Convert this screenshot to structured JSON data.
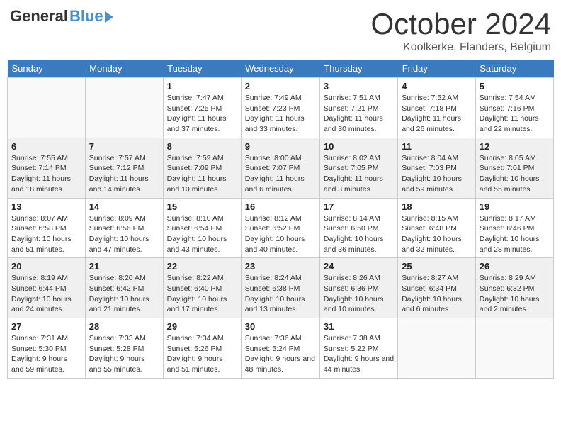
{
  "logo": {
    "general": "General",
    "blue": "Blue"
  },
  "title": "October 2024",
  "location": "Koolkerke, Flanders, Belgium",
  "weekdays": [
    "Sunday",
    "Monday",
    "Tuesday",
    "Wednesday",
    "Thursday",
    "Friday",
    "Saturday"
  ],
  "weeks": [
    [
      {
        "day": "",
        "sunrise": "",
        "sunset": "",
        "daylight": ""
      },
      {
        "day": "",
        "sunrise": "",
        "sunset": "",
        "daylight": ""
      },
      {
        "day": "1",
        "sunrise": "Sunrise: 7:47 AM",
        "sunset": "Sunset: 7:25 PM",
        "daylight": "Daylight: 11 hours and 37 minutes."
      },
      {
        "day": "2",
        "sunrise": "Sunrise: 7:49 AM",
        "sunset": "Sunset: 7:23 PM",
        "daylight": "Daylight: 11 hours and 33 minutes."
      },
      {
        "day": "3",
        "sunrise": "Sunrise: 7:51 AM",
        "sunset": "Sunset: 7:21 PM",
        "daylight": "Daylight: 11 hours and 30 minutes."
      },
      {
        "day": "4",
        "sunrise": "Sunrise: 7:52 AM",
        "sunset": "Sunset: 7:18 PM",
        "daylight": "Daylight: 11 hours and 26 minutes."
      },
      {
        "day": "5",
        "sunrise": "Sunrise: 7:54 AM",
        "sunset": "Sunset: 7:16 PM",
        "daylight": "Daylight: 11 hours and 22 minutes."
      }
    ],
    [
      {
        "day": "6",
        "sunrise": "Sunrise: 7:55 AM",
        "sunset": "Sunset: 7:14 PM",
        "daylight": "Daylight: 11 hours and 18 minutes."
      },
      {
        "day": "7",
        "sunrise": "Sunrise: 7:57 AM",
        "sunset": "Sunset: 7:12 PM",
        "daylight": "Daylight: 11 hours and 14 minutes."
      },
      {
        "day": "8",
        "sunrise": "Sunrise: 7:59 AM",
        "sunset": "Sunset: 7:09 PM",
        "daylight": "Daylight: 11 hours and 10 minutes."
      },
      {
        "day": "9",
        "sunrise": "Sunrise: 8:00 AM",
        "sunset": "Sunset: 7:07 PM",
        "daylight": "Daylight: 11 hours and 6 minutes."
      },
      {
        "day": "10",
        "sunrise": "Sunrise: 8:02 AM",
        "sunset": "Sunset: 7:05 PM",
        "daylight": "Daylight: 11 hours and 3 minutes."
      },
      {
        "day": "11",
        "sunrise": "Sunrise: 8:04 AM",
        "sunset": "Sunset: 7:03 PM",
        "daylight": "Daylight: 10 hours and 59 minutes."
      },
      {
        "day": "12",
        "sunrise": "Sunrise: 8:05 AM",
        "sunset": "Sunset: 7:01 PM",
        "daylight": "Daylight: 10 hours and 55 minutes."
      }
    ],
    [
      {
        "day": "13",
        "sunrise": "Sunrise: 8:07 AM",
        "sunset": "Sunset: 6:58 PM",
        "daylight": "Daylight: 10 hours and 51 minutes."
      },
      {
        "day": "14",
        "sunrise": "Sunrise: 8:09 AM",
        "sunset": "Sunset: 6:56 PM",
        "daylight": "Daylight: 10 hours and 47 minutes."
      },
      {
        "day": "15",
        "sunrise": "Sunrise: 8:10 AM",
        "sunset": "Sunset: 6:54 PM",
        "daylight": "Daylight: 10 hours and 43 minutes."
      },
      {
        "day": "16",
        "sunrise": "Sunrise: 8:12 AM",
        "sunset": "Sunset: 6:52 PM",
        "daylight": "Daylight: 10 hours and 40 minutes."
      },
      {
        "day": "17",
        "sunrise": "Sunrise: 8:14 AM",
        "sunset": "Sunset: 6:50 PM",
        "daylight": "Daylight: 10 hours and 36 minutes."
      },
      {
        "day": "18",
        "sunrise": "Sunrise: 8:15 AM",
        "sunset": "Sunset: 6:48 PM",
        "daylight": "Daylight: 10 hours and 32 minutes."
      },
      {
        "day": "19",
        "sunrise": "Sunrise: 8:17 AM",
        "sunset": "Sunset: 6:46 PM",
        "daylight": "Daylight: 10 hours and 28 minutes."
      }
    ],
    [
      {
        "day": "20",
        "sunrise": "Sunrise: 8:19 AM",
        "sunset": "Sunset: 6:44 PM",
        "daylight": "Daylight: 10 hours and 24 minutes."
      },
      {
        "day": "21",
        "sunrise": "Sunrise: 8:20 AM",
        "sunset": "Sunset: 6:42 PM",
        "daylight": "Daylight: 10 hours and 21 minutes."
      },
      {
        "day": "22",
        "sunrise": "Sunrise: 8:22 AM",
        "sunset": "Sunset: 6:40 PM",
        "daylight": "Daylight: 10 hours and 17 minutes."
      },
      {
        "day": "23",
        "sunrise": "Sunrise: 8:24 AM",
        "sunset": "Sunset: 6:38 PM",
        "daylight": "Daylight: 10 hours and 13 minutes."
      },
      {
        "day": "24",
        "sunrise": "Sunrise: 8:26 AM",
        "sunset": "Sunset: 6:36 PM",
        "daylight": "Daylight: 10 hours and 10 minutes."
      },
      {
        "day": "25",
        "sunrise": "Sunrise: 8:27 AM",
        "sunset": "Sunset: 6:34 PM",
        "daylight": "Daylight: 10 hours and 6 minutes."
      },
      {
        "day": "26",
        "sunrise": "Sunrise: 8:29 AM",
        "sunset": "Sunset: 6:32 PM",
        "daylight": "Daylight: 10 hours and 2 minutes."
      }
    ],
    [
      {
        "day": "27",
        "sunrise": "Sunrise: 7:31 AM",
        "sunset": "Sunset: 5:30 PM",
        "daylight": "Daylight: 9 hours and 59 minutes."
      },
      {
        "day": "28",
        "sunrise": "Sunrise: 7:33 AM",
        "sunset": "Sunset: 5:28 PM",
        "daylight": "Daylight: 9 hours and 55 minutes."
      },
      {
        "day": "29",
        "sunrise": "Sunrise: 7:34 AM",
        "sunset": "Sunset: 5:26 PM",
        "daylight": "Daylight: 9 hours and 51 minutes."
      },
      {
        "day": "30",
        "sunrise": "Sunrise: 7:36 AM",
        "sunset": "Sunset: 5:24 PM",
        "daylight": "Daylight: 9 hours and 48 minutes."
      },
      {
        "day": "31",
        "sunrise": "Sunrise: 7:38 AM",
        "sunset": "Sunset: 5:22 PM",
        "daylight": "Daylight: 9 hours and 44 minutes."
      },
      {
        "day": "",
        "sunrise": "",
        "sunset": "",
        "daylight": ""
      },
      {
        "day": "",
        "sunrise": "",
        "sunset": "",
        "daylight": ""
      }
    ]
  ]
}
